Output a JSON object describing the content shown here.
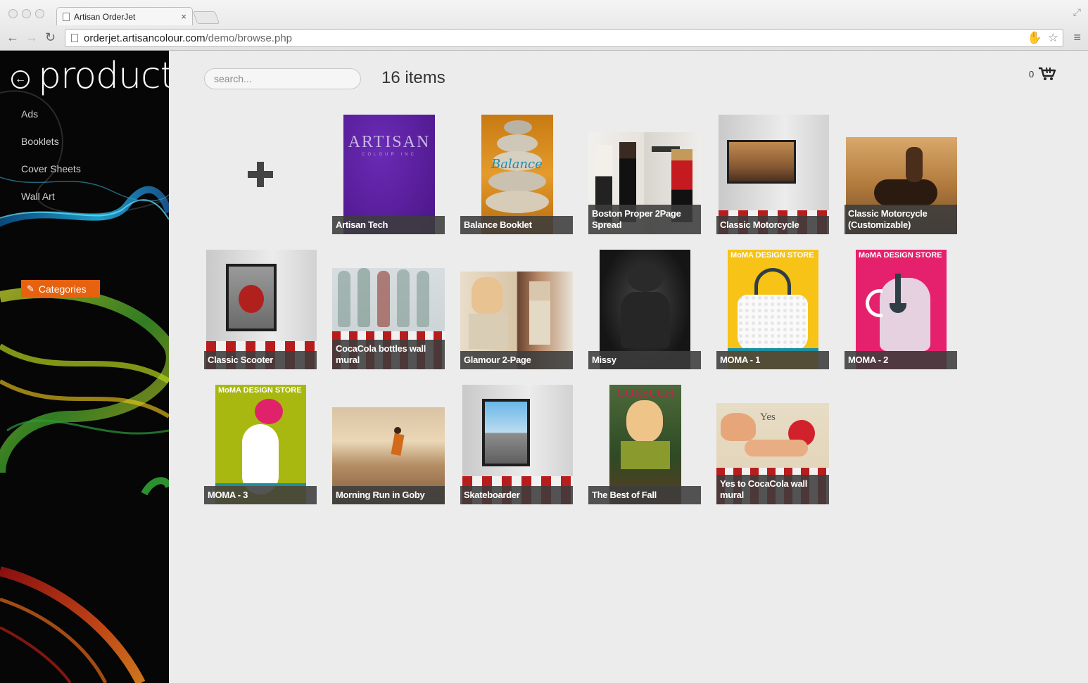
{
  "browser": {
    "tab_title": "Artisan OrderJet",
    "tab_close": "×",
    "url_host": "orderjet.artisancolour.com",
    "url_path": "/demo/browse.php"
  },
  "sidebar": {
    "title": "products",
    "back_icon": "arrow-left-circle-icon",
    "items": [
      "Ads",
      "Booklets",
      "Cover Sheets",
      "Wall Art"
    ],
    "categories_label": "Categories",
    "accent": "#e7620f"
  },
  "header": {
    "search_placeholder": "search...",
    "count_label": "16 items",
    "cart_count": "0"
  },
  "add_icon": "plus-icon",
  "products": [
    {
      "name": "Artisan Tech",
      "thumb_text": "ARTISAN",
      "thumb_sub": "COLOUR INC"
    },
    {
      "name": "Balance Booklet",
      "thumb_text": "Balance"
    },
    {
      "name": "Boston Proper 2Page Spread"
    },
    {
      "name": "Classic Motorcycle"
    },
    {
      "name": "Classic Motorcycle (Customizable)"
    },
    {
      "name": "Classic Scooter"
    },
    {
      "name": "CocaCola bottles wall mural"
    },
    {
      "name": "Glamour 2-Page"
    },
    {
      "name": "Missy"
    },
    {
      "name": "MOMA - 1",
      "thumb_text": "MoMA DESIGN STORE"
    },
    {
      "name": "MOMA - 2",
      "thumb_text": "MoMA DESIGN STORE"
    },
    {
      "name": "MOMA - 3",
      "thumb_text": "MoMA DESIGN STORE"
    },
    {
      "name": "Morning Run in Goby"
    },
    {
      "name": "Skateboarder"
    },
    {
      "name": "The Best of Fall",
      "thumb_text": "GORSUCH"
    },
    {
      "name": "Yes to CocaCola wall mural",
      "thumb_text": "Yes"
    }
  ]
}
